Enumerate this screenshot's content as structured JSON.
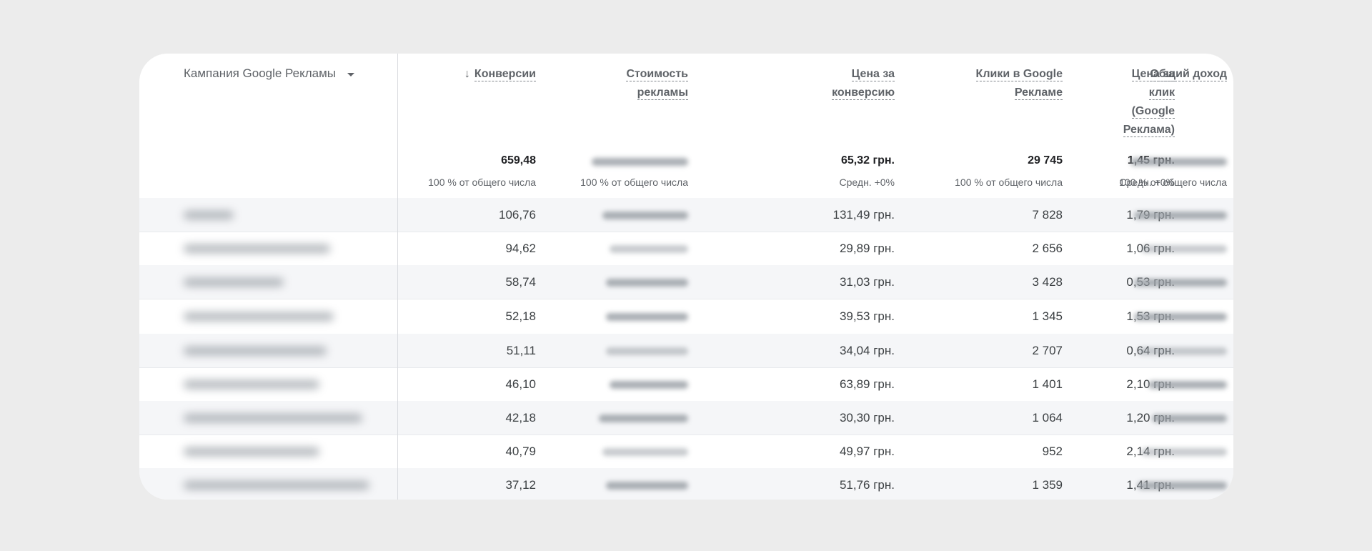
{
  "table": {
    "dimension_header": "Кампания Google Рекламы",
    "columns": [
      {
        "key": "conversions",
        "label_lines": [
          "Конверсии"
        ],
        "sorted_desc": true,
        "sort_arrow": "↓",
        "total": "659,48",
        "total_sub": "100 % от общего числа"
      },
      {
        "key": "ad_cost",
        "label_lines": [
          "Стоимость",
          "рекламы"
        ],
        "total": "",
        "total_sub": "100 % от общего числа"
      },
      {
        "key": "cost_per_conversion",
        "label_lines": [
          "Цена за",
          "конверсию"
        ],
        "total": "65,32 грн.",
        "total_sub": "Средн. +0%"
      },
      {
        "key": "clicks",
        "label_lines": [
          "Клики в Google",
          "Рекламе"
        ],
        "total": "29 745",
        "total_sub": "100 % от общего числа"
      },
      {
        "key": "cpc",
        "label_lines": [
          "Цена за",
          "клик",
          "(Google",
          "Реклама)"
        ],
        "total": "1,45 грн.",
        "total_sub": "Средн. +0%"
      },
      {
        "key": "total_revenue",
        "label_lines": [
          "Общий доход"
        ],
        "total": "",
        "total_sub": "100 % от общего числа"
      }
    ],
    "rows": [
      {
        "conversions": "106,76",
        "cost_per_conversion": "131,49 грн.",
        "clicks": "7 828",
        "cpc": "1,79 грн."
      },
      {
        "conversions": "94,62",
        "cost_per_conversion": "29,89 грн.",
        "clicks": "2 656",
        "cpc": "1,06 грн."
      },
      {
        "conversions": "58,74",
        "cost_per_conversion": "31,03 грн.",
        "clicks": "3 428",
        "cpc": "0,53 грн."
      },
      {
        "conversions": "52,18",
        "cost_per_conversion": "39,53 грн.",
        "clicks": "1 345",
        "cpc": "1,53 грн."
      },
      {
        "conversions": "51,11",
        "cost_per_conversion": "34,04 грн.",
        "clicks": "2 707",
        "cpc": "0,64 грн."
      },
      {
        "conversions": "46,10",
        "cost_per_conversion": "63,89 грн.",
        "clicks": "1 401",
        "cpc": "2,10 грн."
      },
      {
        "conversions": "42,18",
        "cost_per_conversion": "30,30 грн.",
        "clicks": "1 064",
        "cpc": "1,20 грн."
      },
      {
        "conversions": "40,79",
        "cost_per_conversion": "49,97 грн.",
        "clicks": "952",
        "cpc": "2,14 грн."
      },
      {
        "conversions": "37,12",
        "cost_per_conversion": "51,76 грн.",
        "clicks": "1 359",
        "cpc": "1,41 грн."
      }
    ]
  },
  "colors": {
    "background": "#ececec",
    "card": "#ffffff",
    "alt_row": "#f5f6f8",
    "header_text": "#5f6368",
    "value_text": "#3c4043"
  }
}
